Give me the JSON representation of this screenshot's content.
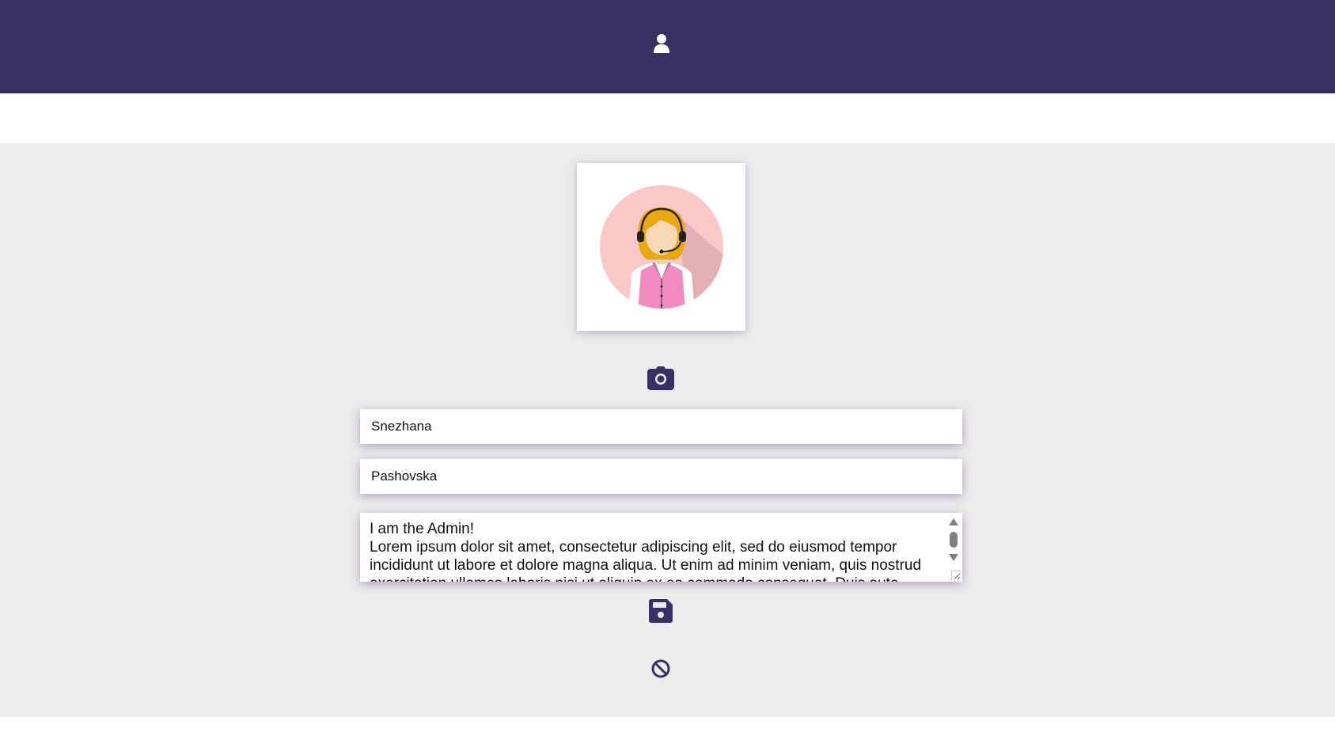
{
  "header": {
    "background_color": "#383063",
    "icon": "user-icon"
  },
  "profile": {
    "avatar_icon": "support-agent-avatar",
    "change_photo_icon": "camera-icon",
    "first_name": "Snezhana",
    "last_name": "Pashovska",
    "bio": "I am the Admin!\nLorem ipsum dolor sit amet, consectetur adipiscing elit, sed do eiusmod tempor incididunt ut labore et dolore magna aliqua. Ut enim ad minim veniam, quis nostrud exercitation ullamco laboris nisi ut aliquip ex ea commodo consequat. Duis aute"
  },
  "actions": {
    "save_icon": "floppy-disk-icon",
    "cancel_icon": "ban-icon",
    "accent_color": "#383063"
  },
  "content_background": "#ececec"
}
